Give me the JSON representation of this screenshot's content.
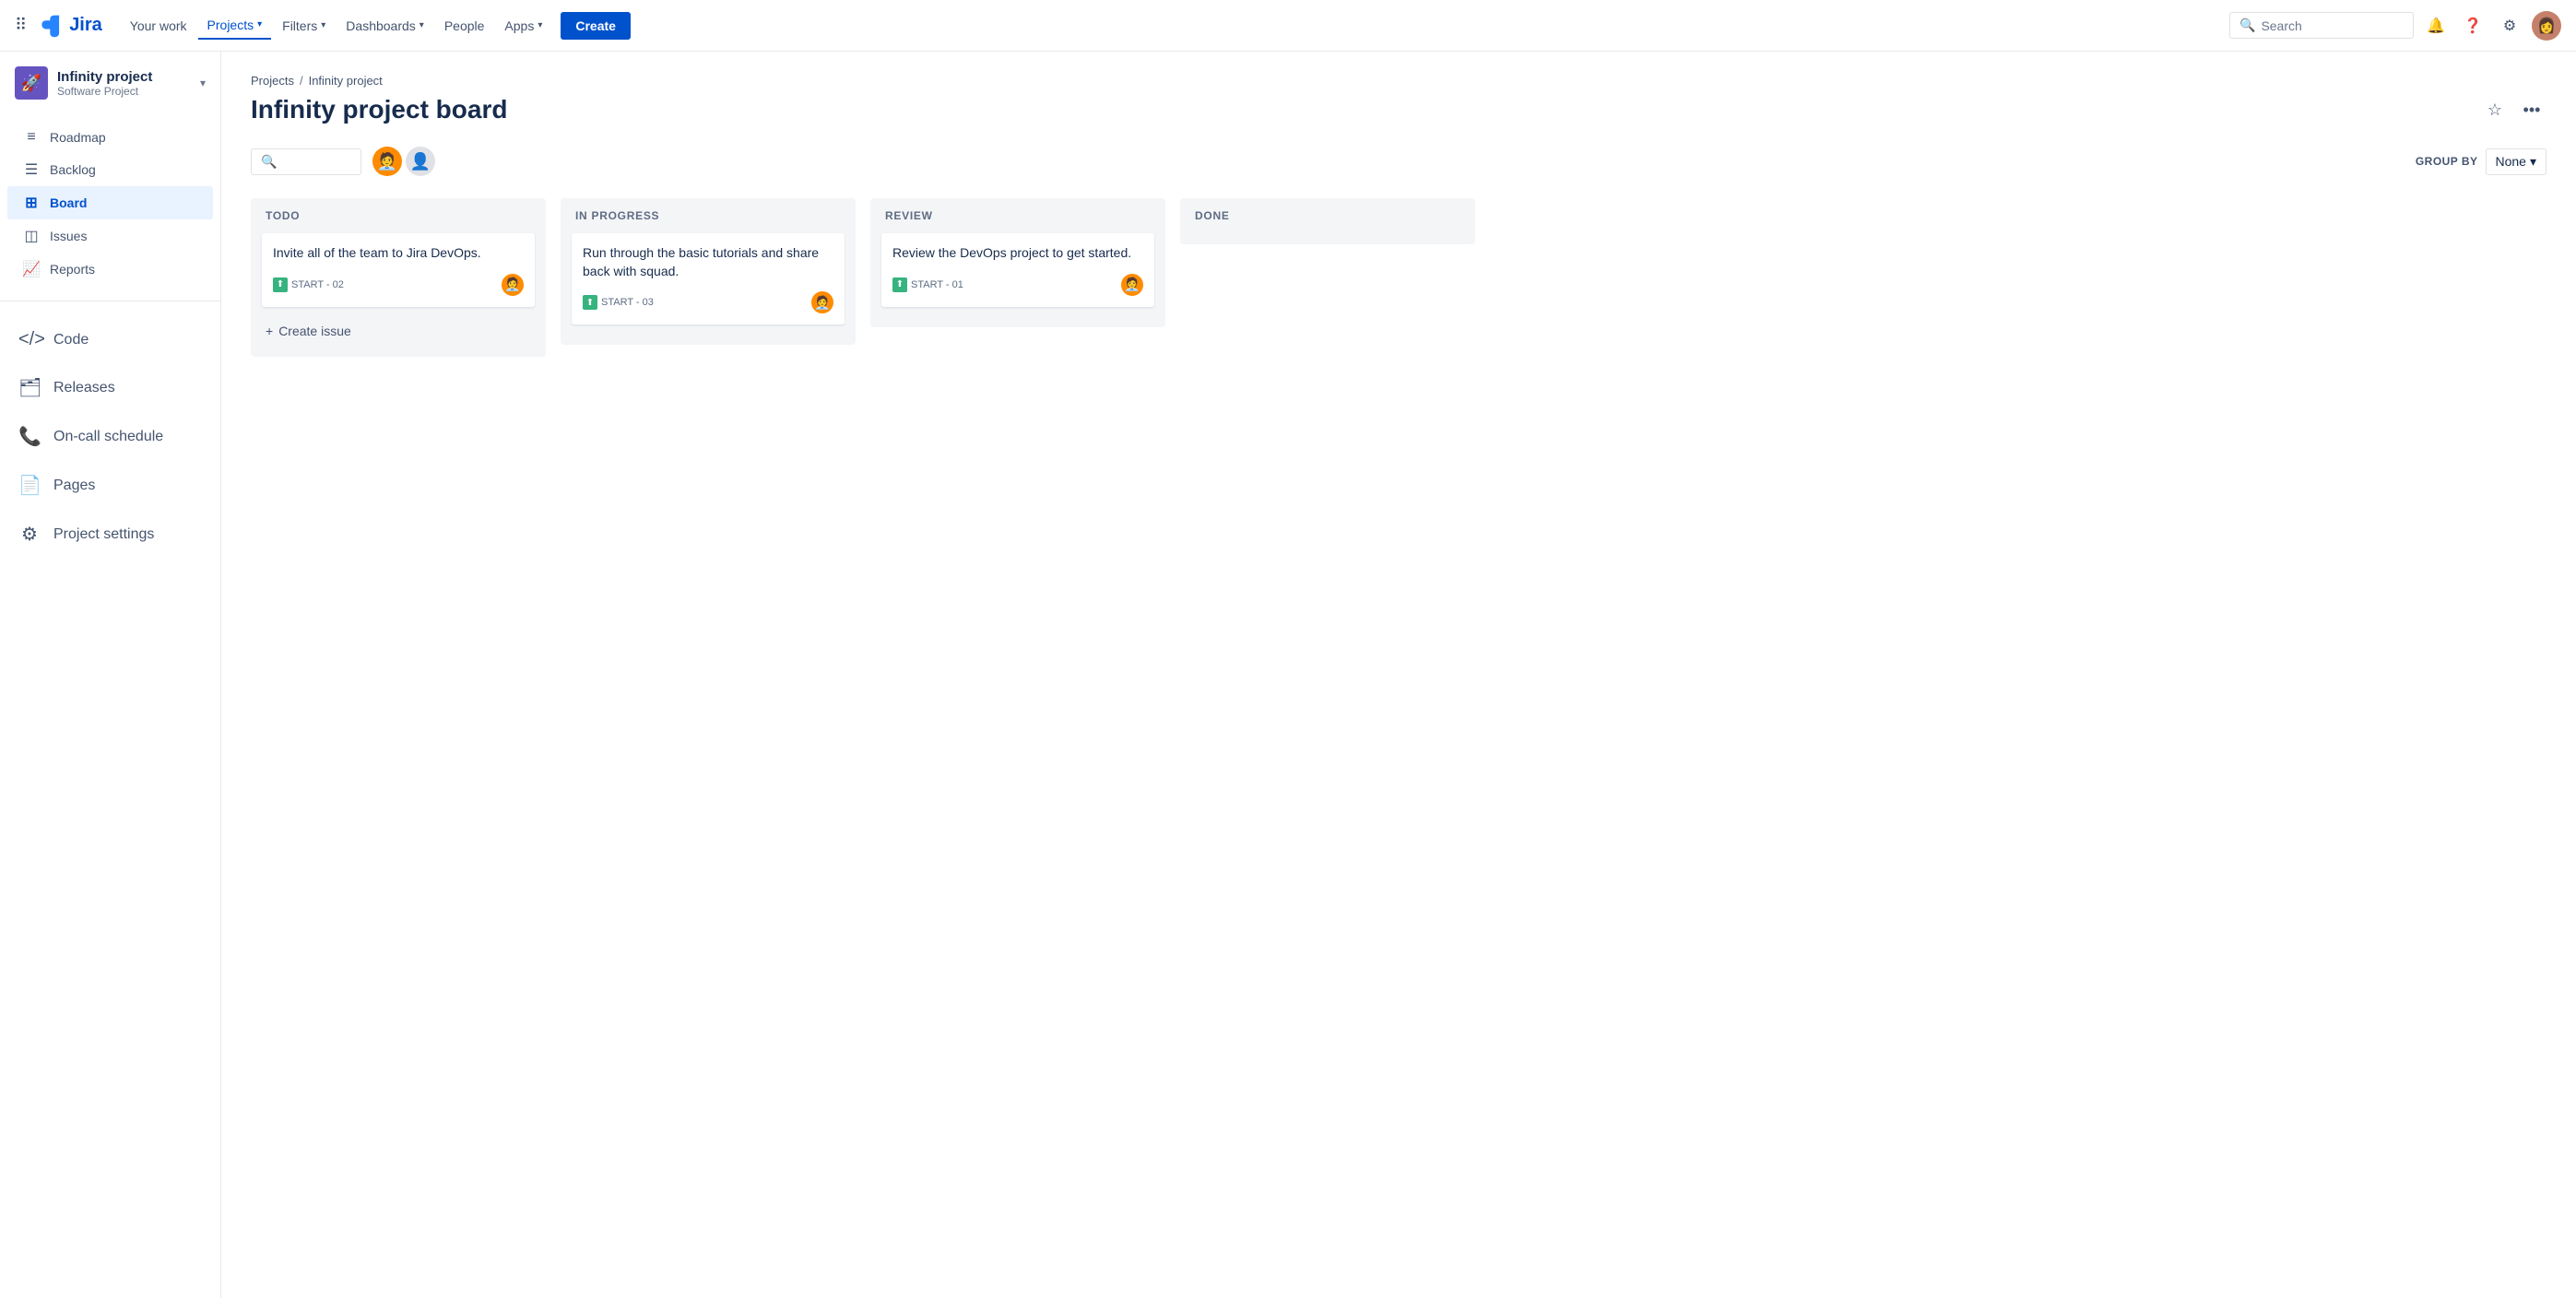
{
  "topnav": {
    "logo_text": "Jira",
    "links": [
      {
        "label": "Your work",
        "active": false
      },
      {
        "label": "Projects",
        "active": true,
        "has_dropdown": true
      },
      {
        "label": "Filters",
        "active": false,
        "has_dropdown": true
      },
      {
        "label": "Dashboards",
        "active": false,
        "has_dropdown": true
      },
      {
        "label": "People",
        "active": false
      },
      {
        "label": "Apps",
        "active": false,
        "has_dropdown": true
      }
    ],
    "create_label": "Create",
    "search_placeholder": "Search"
  },
  "sidebar": {
    "project_name": "Infinity project",
    "project_type": "Software Project",
    "nav_items": [
      {
        "label": "Roadmap",
        "icon": "≡"
      },
      {
        "label": "Backlog",
        "icon": "☰"
      },
      {
        "label": "Board",
        "icon": "⊞",
        "active": true
      },
      {
        "label": "Issues",
        "icon": "◫"
      },
      {
        "label": "Reports",
        "icon": "📈"
      }
    ],
    "big_items": [
      {
        "label": "Code",
        "icon": "</>"
      },
      {
        "label": "Releases",
        "icon": "🗂"
      },
      {
        "label": "On-call schedule",
        "icon": "📞"
      },
      {
        "label": "Pages",
        "icon": "📄"
      },
      {
        "label": "Project settings",
        "icon": "⚙"
      }
    ]
  },
  "breadcrumb": {
    "items": [
      "Projects",
      "Infinity project"
    ]
  },
  "page": {
    "title": "Infinity project board",
    "group_by_label": "GROUP BY",
    "group_by_value": "None"
  },
  "board": {
    "columns": [
      {
        "id": "todo",
        "header": "TODO",
        "cards": [
          {
            "title": "Invite all of the team to Jira DevOps.",
            "badge": "START - 02",
            "avatar": "🧑‍💼"
          }
        ],
        "create_label": "Create issue"
      },
      {
        "id": "inprogress",
        "header": "IN PROGRESS",
        "cards": [
          {
            "title": "Run through the basic tutorials and share back with squad.",
            "badge": "START - 03",
            "avatar": "🧑‍💼"
          }
        ],
        "create_label": null
      },
      {
        "id": "review",
        "header": "REVIEW",
        "cards": [
          {
            "title": "Review the DevOps project to get started.",
            "badge": "START - 01",
            "avatar": "🧑‍💼"
          }
        ],
        "create_label": null
      },
      {
        "id": "done",
        "header": "DONE",
        "cards": [],
        "create_label": null
      }
    ]
  }
}
